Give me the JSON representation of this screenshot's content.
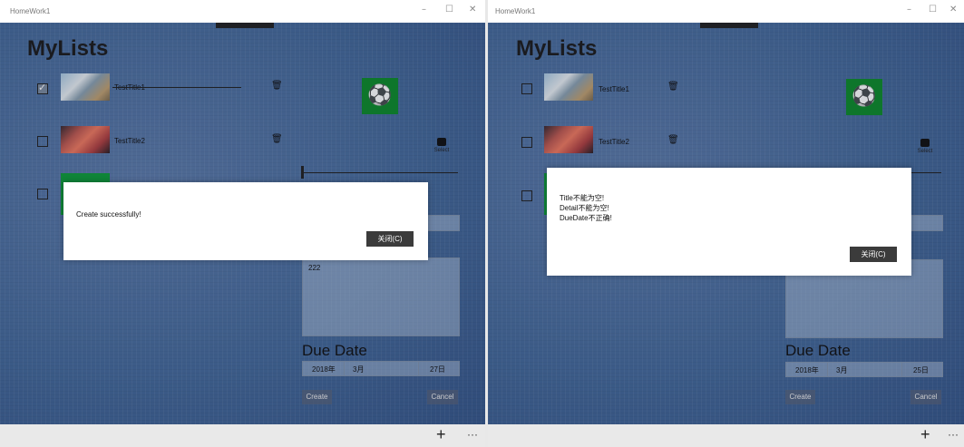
{
  "left": {
    "window_title": "HomeWork1",
    "app_title": "MyLists",
    "items": [
      {
        "title": "TestTitle1"
      },
      {
        "title": "TestTitle2"
      }
    ],
    "select_label": "Select",
    "detail_value": "222",
    "due_label": "Due Date",
    "date": {
      "year": "2018年",
      "month": "3月",
      "day": "27日"
    },
    "create_label": "Create",
    "cancel_label": "Cancel",
    "dialog": {
      "message": "Create successfully!",
      "close_label": "关闭(C)"
    }
  },
  "right": {
    "window_title": "HomeWork1",
    "app_title": "MyLists",
    "items": [
      {
        "title": "TestTitle1"
      },
      {
        "title": "TestTitle2"
      }
    ],
    "select_label": "Select",
    "due_label": "Due Date",
    "date": {
      "year": "2018年",
      "month": "3月",
      "day": "25日"
    },
    "create_label": "Create",
    "cancel_label": "Cancel",
    "dialog": {
      "lines": [
        "Title不能为空!",
        "Detail不能为空!",
        "DueDate不正确!"
      ],
      "close_label": "关闭(C)"
    }
  },
  "window_controls": {
    "minimize": "–",
    "maximize": "☐",
    "close": "✕"
  },
  "appbar": {
    "add_glyph": "+",
    "more_glyph": "···"
  },
  "icons": {
    "ball": "soccer-ball-icon",
    "trash": "trash-icon",
    "select": "select-icon"
  },
  "colors": {
    "accent_green": "#0d8a2a",
    "dialog_button": "#3b3b3b"
  }
}
